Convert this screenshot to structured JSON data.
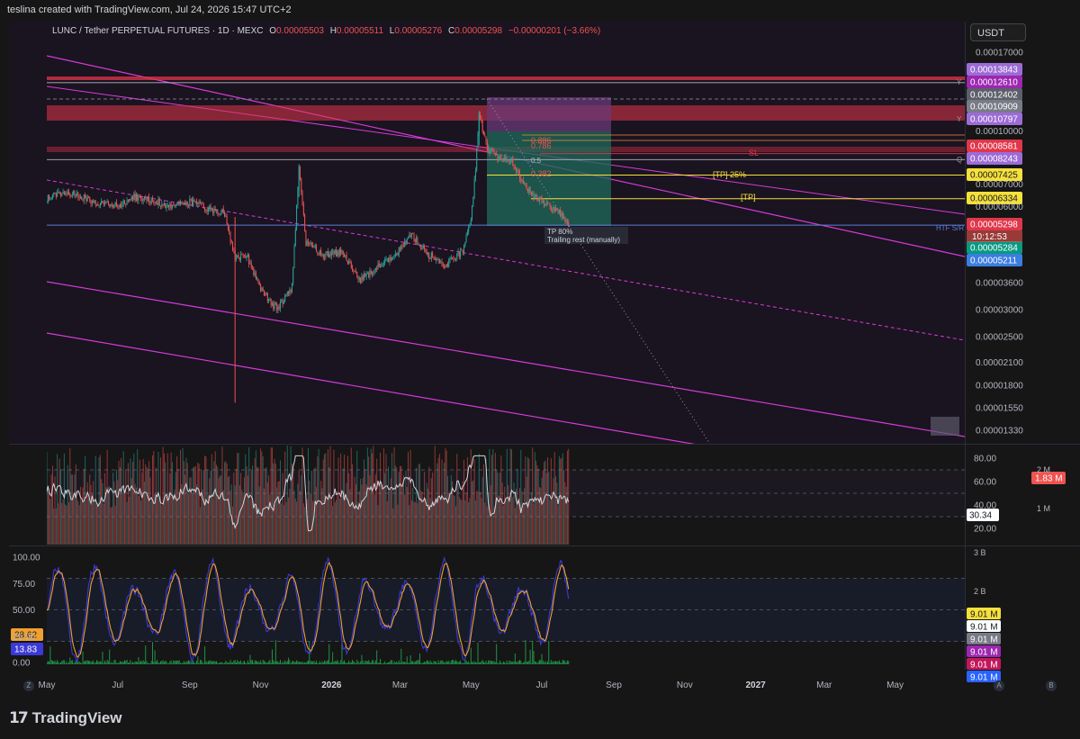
{
  "header": {
    "credit": "teslina created with TradingView.com, Jul 24, 2026 15:47 UTC+2"
  },
  "legend": {
    "symbol": "LUNC / Tether PERPETUAL FUTURES · 1D · MEXC",
    "o_label": "O",
    "o": "0.00005503",
    "h_label": "H",
    "h": "0.00005511",
    "l_label": "L",
    "l": "0.00005276",
    "c_label": "C",
    "c": "0.00005298",
    "change": "−0.00000201 (−3.66%)"
  },
  "currency_button": "USDT",
  "brand": {
    "mark": "17",
    "name": "TradingView"
  },
  "colors": {
    "background": "#161616",
    "pane": "#1a1320",
    "candle_up": "#26a69a",
    "candle_down": "#ef5350",
    "channel": "#d43cd6",
    "red_zone": "#e0364a",
    "tp_line": "#f5e03c",
    "orange_line": "#f08a3a",
    "blue_line": "#5b7fd6",
    "position_green": "#1f6b5a",
    "position_purple": "#6b3a78",
    "rsi_line": "#d1d4dc",
    "stoch_k": "#3a3ad6",
    "stoch_d": "#f0a030",
    "volume_green": "#1fa050"
  },
  "chart_data": [
    {
      "type": "candlestick",
      "pane": "price",
      "scale": "log",
      "x_range": [
        "2025-05-01",
        "2027-06-30"
      ],
      "x_ticks": [
        "May",
        "Jul",
        "Sep",
        "Nov",
        "2026",
        "Mar",
        "May",
        "Jul",
        "Sep",
        "Nov",
        "2027",
        "Mar",
        "May"
      ],
      "x_tick_dates": [
        "2025-05-01",
        "2025-07-01",
        "2025-09-01",
        "2025-11-01",
        "2026-01-01",
        "2026-03-01",
        "2026-05-01",
        "2026-07-01",
        "2026-09-01",
        "2026-11-01",
        "2027-01-01",
        "2027-03-01",
        "2027-05-01"
      ],
      "y_range": [
        1.22e-05,
        1.78e-05
      ],
      "y_ticks": [
        "0.00017000",
        "0.00010000",
        "0.00007000",
        "0.00006000",
        "0.00003600",
        "0.00003000",
        "0.00002500",
        "0.00002100",
        "0.00001800",
        "0.00001550",
        "0.00001330"
      ],
      "y_tick_values": [
        0.00017,
        0.0001,
        7e-05,
        6e-05,
        3.6e-05,
        3e-05,
        2.5e-05,
        2.1e-05,
        1.8e-05,
        1.55e-05,
        1.33e-05
      ],
      "close_series": [
        [
          "2025-05-01",
          6.35e-05
        ],
        [
          "2025-05-15",
          6.65e-05
        ],
        [
          "2025-06-01",
          6.4e-05
        ],
        [
          "2025-06-15",
          6.15e-05
        ],
        [
          "2025-07-01",
          6.02e-05
        ],
        [
          "2025-07-15",
          6.4e-05
        ],
        [
          "2025-08-01",
          6.25e-05
        ],
        [
          "2025-08-15",
          6.03e-05
        ],
        [
          "2025-09-01",
          6.2e-05
        ],
        [
          "2025-09-15",
          5.95e-05
        ],
        [
          "2025-10-01",
          5.75e-05
        ],
        [
          "2025-10-10",
          4.2e-05
        ],
        [
          "2025-10-20",
          4.35e-05
        ],
        [
          "2025-11-01",
          3.45e-05
        ],
        [
          "2025-11-15",
          3e-05
        ],
        [
          "2025-11-28",
          3.5e-05
        ],
        [
          "2025-12-04",
          7.8e-05
        ],
        [
          "2025-12-10",
          4.7e-05
        ],
        [
          "2025-12-25",
          4.35e-05
        ],
        [
          "2026-01-10",
          4.4e-05
        ],
        [
          "2026-01-25",
          3.65e-05
        ],
        [
          "2026-02-10",
          4e-05
        ],
        [
          "2026-02-25",
          4.3e-05
        ],
        [
          "2026-03-10",
          5e-05
        ],
        [
          "2026-03-25",
          4.35e-05
        ],
        [
          "2026-04-10",
          4.05e-05
        ],
        [
          "2026-04-25",
          4.5e-05
        ],
        [
          "2026-05-01",
          5.6e-05
        ],
        [
          "2026-05-05",
          7.7e-05
        ],
        [
          "2026-05-08",
          0.000112
        ],
        [
          "2026-05-15",
          8.9e-05
        ],
        [
          "2026-05-25",
          8.3e-05
        ],
        [
          "2026-06-05",
          8.2e-05
        ],
        [
          "2026-06-15",
          7e-05
        ],
        [
          "2026-06-25",
          6.4e-05
        ],
        [
          "2026-07-05",
          6.1e-05
        ],
        [
          "2026-07-15",
          5.8e-05
        ],
        [
          "2026-07-24",
          5.3e-05
        ]
      ],
      "wick_extremes": {
        "low": [
          [
            "2025-10-10",
            1.6e-05
          ]
        ],
        "high": [
          [
            "2025-12-04",
            8e-05
          ],
          [
            "2026-05-08",
            0.0001135
          ]
        ]
      },
      "horizontal_levels": [
        {
          "label": "0.00013843",
          "value": 0.00013843,
          "color": "#9c6bd6"
        },
        {
          "label": "0.00012610",
          "value": 0.0001261,
          "color": "#9c27b0"
        },
        {
          "label": "0.00012402",
          "value": 0.00012402,
          "color": "#5d606b"
        },
        {
          "label": "0.00010909",
          "value": 0.00010909,
          "color": "#787b86"
        },
        {
          "label": "0.00010797",
          "value": 0.00010797,
          "color": "#9c6bd6"
        },
        {
          "label": "0.00008581",
          "value": 8.581e-05,
          "color": "#e0364a"
        },
        {
          "label": "0.00008243",
          "value": 8.243e-05,
          "color": "#9c6bd6"
        },
        {
          "label": "0.00007425",
          "value": 7.425e-05,
          "color": "#f5e03c"
        },
        {
          "label": "0.00006334",
          "value": 6.334e-05,
          "color": "#f5e03c"
        },
        {
          "label": "0.00005298",
          "value": 5.298e-05,
          "color": "#e0364a"
        },
        {
          "label": "0.00005284",
          "value": 5.284e-05,
          "color": "#089981"
        },
        {
          "label": "0.00005211",
          "value": 5.211e-05,
          "color": "#3b7de0"
        }
      ],
      "countdown": "10:12:53",
      "annotations": {
        "sl": "SL",
        "tp25": "[TP] 25%",
        "tp": "[TP]",
        "htf": "HTF S/R",
        "tp80": "TP 80%",
        "trailing": "Trailing rest (manually)",
        "fib_0886": "0.886",
        "fib_0786": "0.786",
        "fib_05": "0.5",
        "fib_0382": "0.382",
        "y_tag": "Y",
        "q_tag": "Q"
      }
    },
    {
      "type": "line",
      "pane": "rsi",
      "y_range": [
        12,
        82
      ],
      "y_ticks": [
        "80.00",
        "60.00",
        "40.00",
        "20.00"
      ],
      "y_tick_values": [
        80,
        60,
        40,
        20
      ],
      "levels": [
        70,
        50,
        30
      ],
      "current": "30.34",
      "volume_overlay_labels": [
        "2 M",
        "1 M"
      ],
      "volume_current": "1.83 M"
    },
    {
      "type": "line",
      "pane": "stochastic",
      "y_range": [
        -2,
        107
      ],
      "y_ticks": [
        "100.00",
        "75.00",
        "50.00",
        "25.00",
        "0.00"
      ],
      "y_tick_values": [
        100,
        75,
        50,
        25,
        0
      ],
      "levels": [
        80,
        50,
        20
      ],
      "series": [
        {
          "key": "d",
          "current": "28.62",
          "color": "#f0a030"
        },
        {
          "key": "k",
          "current": "13.83",
          "color": "#3a3ad6"
        }
      ],
      "right_scale_labels": [
        "3 B",
        "2 B"
      ],
      "right_value_labels": [
        {
          "label": "9.01 M",
          "color": "#f5e03c"
        },
        {
          "label": "9.01 M",
          "color": "#ffffff"
        },
        {
          "label": "9.01 M",
          "color": "#787b86"
        },
        {
          "label": "9.01 M",
          "color": "#9c27b0"
        },
        {
          "label": "9.01 M",
          "color": "#c2185b"
        },
        {
          "label": "9.01 M",
          "color": "#2962ff"
        }
      ]
    }
  ],
  "corner_buttons": [
    "Z",
    "A",
    "B"
  ]
}
